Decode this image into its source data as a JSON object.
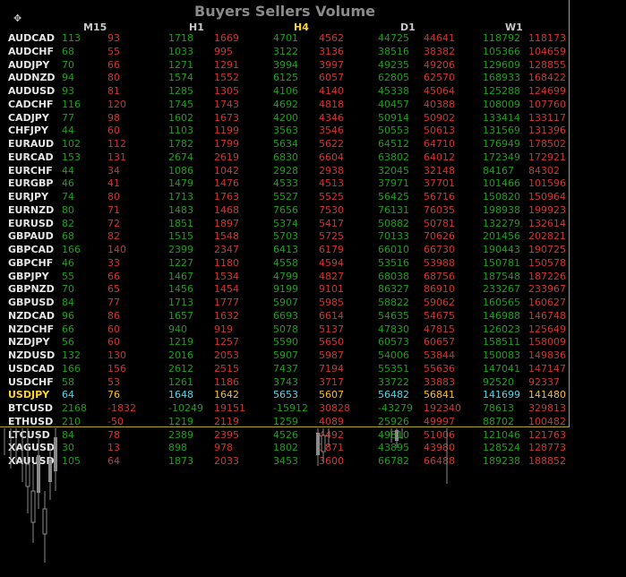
{
  "title": "Buyers Sellers Volume",
  "timeframes": [
    "M15",
    "H1",
    "H4",
    "D1",
    "W1"
  ],
  "active_timeframe": "H4",
  "highlight_symbol": "USDJPY",
  "colors": {
    "buy": "#19a119",
    "sell": "#d23333",
    "highlight_buy": "#4fd7e8",
    "highlight_sell": "#ffc000",
    "highlight_symbol": "#ffd42a",
    "active_timeframe": "#ffd42a",
    "border": "#b8a23a"
  },
  "icons": {
    "move": "move-icon"
  },
  "rows": [
    {
      "symbol": "AUDCAD",
      "vals": [
        "113",
        "93",
        "1718",
        "1669",
        "4701",
        "4562",
        "44725",
        "44641",
        "118792",
        "118173"
      ]
    },
    {
      "symbol": "AUDCHF",
      "vals": [
        "68",
        "55",
        "1033",
        "995",
        "3122",
        "3136",
        "38516",
        "38382",
        "105366",
        "104659"
      ]
    },
    {
      "symbol": "AUDJPY",
      "vals": [
        "70",
        "66",
        "1271",
        "1291",
        "3994",
        "3997",
        "49235",
        "49206",
        "129609",
        "128855"
      ]
    },
    {
      "symbol": "AUDNZD",
      "vals": [
        "94",
        "80",
        "1574",
        "1552",
        "6125",
        "6057",
        "62805",
        "62570",
        "168933",
        "168422"
      ]
    },
    {
      "symbol": "AUDUSD",
      "vals": [
        "93",
        "81",
        "1285",
        "1305",
        "4106",
        "4140",
        "45338",
        "45064",
        "125288",
        "124699"
      ]
    },
    {
      "symbol": "CADCHF",
      "vals": [
        "116",
        "120",
        "1745",
        "1743",
        "4692",
        "4818",
        "40457",
        "40388",
        "108009",
        "107760"
      ]
    },
    {
      "symbol": "CADJPY",
      "vals": [
        "77",
        "98",
        "1602",
        "1673",
        "4200",
        "4346",
        "50914",
        "50902",
        "133414",
        "133117"
      ]
    },
    {
      "symbol": "CHFJPY",
      "vals": [
        "44",
        "60",
        "1103",
        "1199",
        "3563",
        "3546",
        "50553",
        "50613",
        "131569",
        "131396"
      ]
    },
    {
      "symbol": "EURAUD",
      "vals": [
        "102",
        "112",
        "1782",
        "1799",
        "5634",
        "5622",
        "64512",
        "64710",
        "176949",
        "178502"
      ]
    },
    {
      "symbol": "EURCAD",
      "vals": [
        "153",
        "131",
        "2674",
        "2619",
        "6830",
        "6604",
        "63802",
        "64012",
        "172349",
        "172921"
      ]
    },
    {
      "symbol": "EURCHF",
      "vals": [
        "44",
        "34",
        "1086",
        "1042",
        "2928",
        "2938",
        "32045",
        "32148",
        "84167",
        "84302"
      ]
    },
    {
      "symbol": "EURGBP",
      "vals": [
        "46",
        "41",
        "1479",
        "1476",
        "4533",
        "4513",
        "37971",
        "37701",
        "101466",
        "101596"
      ]
    },
    {
      "symbol": "EURJPY",
      "vals": [
        "74",
        "80",
        "1713",
        "1763",
        "5527",
        "5525",
        "56425",
        "56716",
        "150820",
        "150964"
      ]
    },
    {
      "symbol": "EURNZD",
      "vals": [
        "80",
        "71",
        "1483",
        "1468",
        "7656",
        "7530",
        "76131",
        "76035",
        "198938",
        "199923"
      ]
    },
    {
      "symbol": "EURUSD",
      "vals": [
        "82",
        "72",
        "1851",
        "1897",
        "5374",
        "5417",
        "50882",
        "50781",
        "132279",
        "132614"
      ]
    },
    {
      "symbol": "GBPAUD",
      "vals": [
        "68",
        "82",
        "1515",
        "1548",
        "5703",
        "5725",
        "70133",
        "70626",
        "201456",
        "202821"
      ]
    },
    {
      "symbol": "GBPCAD",
      "vals": [
        "166",
        "140",
        "2399",
        "2347",
        "6413",
        "6179",
        "66010",
        "66730",
        "190443",
        "190725"
      ]
    },
    {
      "symbol": "GBPCHF",
      "vals": [
        "46",
        "33",
        "1227",
        "1180",
        "4558",
        "4594",
        "53516",
        "53988",
        "150781",
        "150578"
      ]
    },
    {
      "symbol": "GBPJPY",
      "vals": [
        "55",
        "66",
        "1467",
        "1534",
        "4799",
        "4827",
        "68038",
        "68756",
        "187548",
        "187226"
      ]
    },
    {
      "symbol": "GBPNZD",
      "vals": [
        "70",
        "65",
        "1456",
        "1454",
        "9199",
        "9101",
        "86327",
        "86910",
        "233267",
        "233967"
      ]
    },
    {
      "symbol": "GBPUSD",
      "vals": [
        "84",
        "77",
        "1713",
        "1777",
        "5907",
        "5985",
        "58822",
        "59062",
        "160565",
        "160627"
      ]
    },
    {
      "symbol": "NZDCAD",
      "vals": [
        "96",
        "86",
        "1657",
        "1632",
        "6693",
        "6614",
        "54635",
        "54675",
        "146988",
        "146748"
      ]
    },
    {
      "symbol": "NZDCHF",
      "vals": [
        "66",
        "60",
        "940",
        "919",
        "5078",
        "5137",
        "47830",
        "47815",
        "126023",
        "125649"
      ]
    },
    {
      "symbol": "NZDJPY",
      "vals": [
        "56",
        "60",
        "1219",
        "1257",
        "5590",
        "5650",
        "60573",
        "60657",
        "158511",
        "158009"
      ]
    },
    {
      "symbol": "NZDUSD",
      "vals": [
        "132",
        "130",
        "2016",
        "2053",
        "5907",
        "5987",
        "54006",
        "53844",
        "150083",
        "149836"
      ]
    },
    {
      "symbol": "USDCAD",
      "vals": [
        "166",
        "156",
        "2612",
        "2515",
        "7437",
        "7194",
        "55351",
        "55636",
        "147041",
        "147147"
      ]
    },
    {
      "symbol": "USDCHF",
      "vals": [
        "58",
        "53",
        "1261",
        "1186",
        "3743",
        "3717",
        "33722",
        "33883",
        "92520",
        "92337"
      ]
    },
    {
      "symbol": "USDJPY",
      "vals": [
        "64",
        "76",
        "1648",
        "1642",
        "5653",
        "5607",
        "56482",
        "56841",
        "141699",
        "141480"
      ]
    },
    {
      "symbol": "BTCUSD",
      "vals": [
        "2168",
        "-1832",
        "-10249",
        "19151",
        "-15912",
        "30828",
        "-43279",
        "192340",
        "78613",
        "329813"
      ]
    },
    {
      "symbol": "ETHUSD",
      "vals": [
        "210",
        "-50",
        "1219",
        "2119",
        "1259",
        "4089",
        "25926",
        "49997",
        "88702",
        "100482"
      ]
    },
    {
      "symbol": "LTCUSD",
      "vals": [
        "84",
        "78",
        "2389",
        "2395",
        "4526",
        "4492",
        "49810",
        "51006",
        "121046",
        "121763"
      ]
    },
    {
      "symbol": "XAGUSD",
      "vals": [
        "30",
        "13",
        "898",
        "978",
        "1802",
        "1871",
        "43895",
        "43980",
        "128524",
        "128773"
      ]
    },
    {
      "symbol": "XAUUSD",
      "vals": [
        "105",
        "64",
        "1873",
        "2033",
        "3453",
        "3600",
        "66782",
        "66488",
        "189238",
        "188852"
      ]
    }
  ]
}
